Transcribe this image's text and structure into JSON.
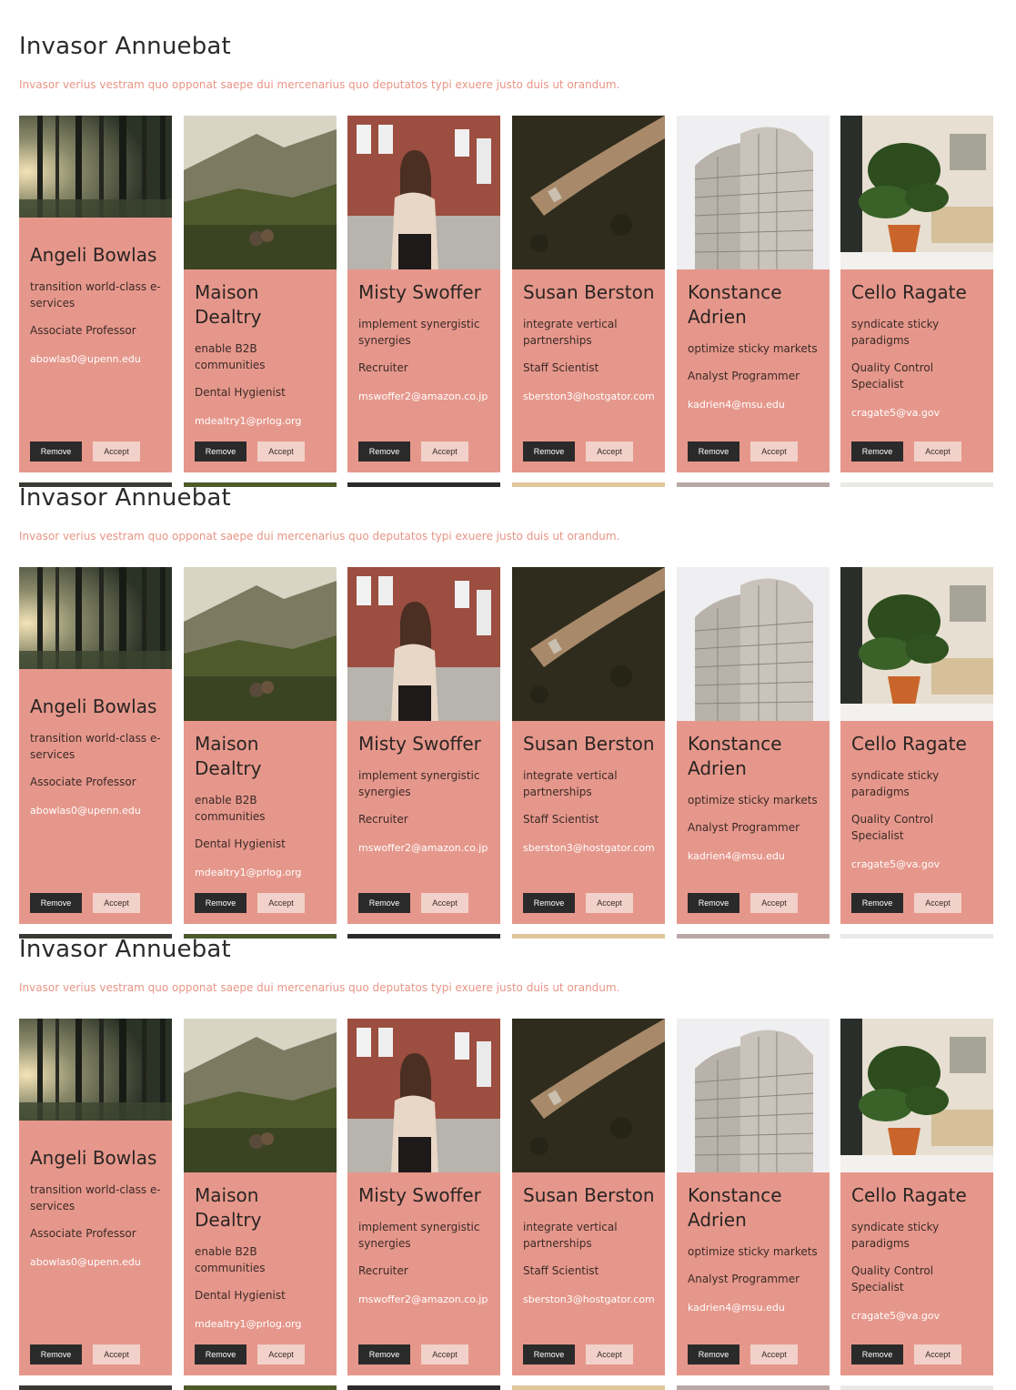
{
  "section": {
    "title": "Invasor Annuebat",
    "subtitle": "Invasor verius vestram quo opponat saepe dui mercenarius quo deputatos typi exuere justo duis ut orandum."
  },
  "buttons": {
    "remove": "Remove",
    "accept": "Accept"
  },
  "cards": [
    {
      "name": "Angeli Bowlas",
      "tagline": "transition world-class e-services",
      "job": "Associate Professor",
      "email": "abowlas0@upenn.edu",
      "photo": "forest-photo"
    },
    {
      "name": "Maison Dealtry",
      "tagline": "enable B2B communities",
      "job": "Dental Hygienist",
      "email": "mdealtry1@prlog.org",
      "photo": "mountain-couple-photo"
    },
    {
      "name": "Misty Swoffer",
      "tagline": "implement synergistic synergies",
      "job": "Recruiter",
      "email": "mswoffer2@amazon.co.jp",
      "photo": "woman-portrait-photo"
    },
    {
      "name": "Susan Berston",
      "tagline": "integrate vertical partnerships",
      "job": "Staff Scientist",
      "email": "sberston3@hostgator.com",
      "photo": "aerial-forest-photo"
    },
    {
      "name": "Konstance Adrien",
      "tagline": "optimize sticky markets",
      "job": "Analyst Programmer",
      "email": "kadrien4@msu.edu",
      "photo": "building-photo"
    },
    {
      "name": "Cello Ragate",
      "tagline": "syndicate sticky paradigms",
      "job": "Quality Control Specialist",
      "email": "cragate5@va.gov",
      "photo": "plant-photo"
    }
  ]
}
